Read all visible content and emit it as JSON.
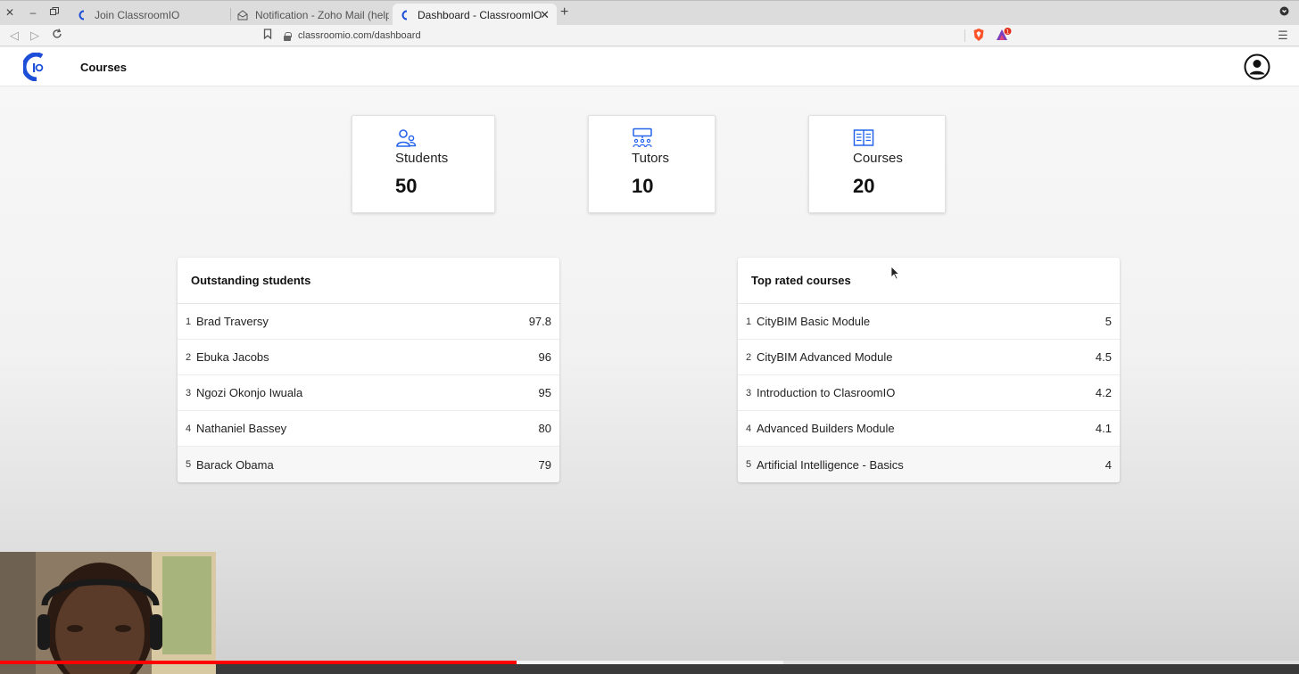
{
  "browser": {
    "tabs": [
      {
        "title": "Join ClassroomIO",
        "active": false
      },
      {
        "title": "Notification - Zoho Mail (help",
        "active": false
      },
      {
        "title": "Dashboard - ClassroomIO",
        "active": true
      }
    ],
    "url": "classroomio.com/dashboard",
    "alert_badge": "1"
  },
  "app": {
    "nav_label": "Courses",
    "brand_color": "#1d4ed8"
  },
  "stats": [
    {
      "label": "Students",
      "value": "50",
      "icon": "students-icon"
    },
    {
      "label": "Tutors",
      "value": "10",
      "icon": "tutors-icon"
    },
    {
      "label": "Courses",
      "value": "20",
      "icon": "courses-icon"
    }
  ],
  "outstanding_students": {
    "title": "Outstanding students",
    "rows": [
      {
        "rank": "1",
        "name": "Brad Traversy",
        "score": "97.8"
      },
      {
        "rank": "2",
        "name": "Ebuka Jacobs",
        "score": "96"
      },
      {
        "rank": "3",
        "name": "Ngozi Okonjo Iwuala",
        "score": "95"
      },
      {
        "rank": "4",
        "name": "Nathaniel Bassey",
        "score": "80"
      },
      {
        "rank": "5",
        "name": "Barack Obama",
        "score": "79"
      }
    ]
  },
  "top_rated_courses": {
    "title": "Top rated courses",
    "rows": [
      {
        "rank": "1",
        "name": "CityBIM Basic Module",
        "score": "5"
      },
      {
        "rank": "2",
        "name": "CityBIM Advanced Module",
        "score": "4.5"
      },
      {
        "rank": "3",
        "name": "Introduction to ClasroomIO",
        "score": "4.2"
      },
      {
        "rank": "4",
        "name": "Advanced Builders Module",
        "score": "4.1"
      },
      {
        "rank": "5",
        "name": "Artificial Intelligence - Basics",
        "score": "4"
      }
    ]
  },
  "video": {
    "played_fraction": 0.398,
    "buffered_fraction": 0.603
  }
}
